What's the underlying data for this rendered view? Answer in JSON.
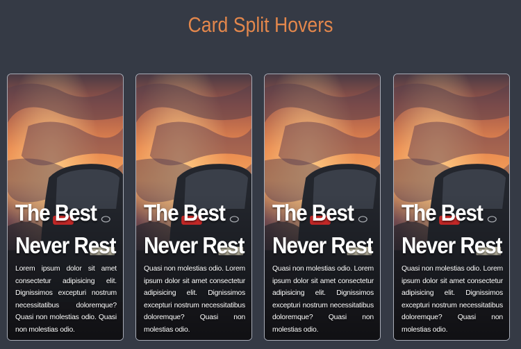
{
  "page": {
    "title": "Card Split Hovers",
    "background_color": "#353a45",
    "title_color": "#e3874c"
  },
  "cards": [
    {
      "heading_line1": "The Best",
      "heading_line2": "Never Rest",
      "body": "Lorem ipsum dolor sit amet consectetur adipisicing elit. Dignissimos excepturi nostrum necessitatibus doloremque? Quasi non molestias odio. Quasi non molestias odio.",
      "image": "sunset-car-photo"
    },
    {
      "heading_line1": "The Best",
      "heading_line2": "Never Rest",
      "body": "Quasi non molestias odio. Lorem ipsum dolor sit amet consectetur adipisicing elit. Dignissimos excepturi nostrum necessitatibus doloremque? Quasi non molestias odio.",
      "image": "sunset-car-photo"
    },
    {
      "heading_line1": "The Best",
      "heading_line2": "Never Rest",
      "body": "Quasi non molestias odio. Lorem ipsum dolor sit amet consectetur adipisicing elit. Dignissimos excepturi nostrum necessitatibus doloremque? Quasi non molestias odio.",
      "image": "sunset-car-photo"
    },
    {
      "heading_line1": "The Best",
      "heading_line2": "Never Rest",
      "body": "Quasi non molestias odio. Lorem ipsum dolor sit amet consectetur adipisicing elit. Dignissimos excepturi nostrum necessitatibus doloremque? Quasi non molestias odio.",
      "image": "sunset-car-photo"
    }
  ]
}
